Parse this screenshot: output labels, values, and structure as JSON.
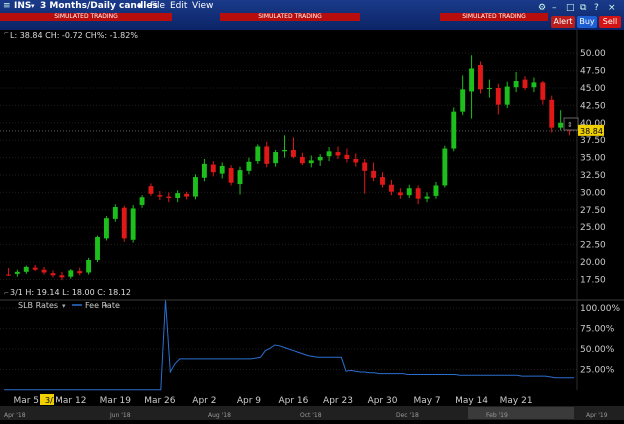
{
  "toolbar": {
    "ticker": "INS",
    "timeframe": "3 Months/Daily candles",
    "menu": [
      "File",
      "Edit",
      "View"
    ],
    "simulated": [
      "SIMULATED TRADING",
      "SIMULATED TRADING",
      "SIMULATED TRADING"
    ],
    "buttons": {
      "alert": "Alert",
      "buy": "Buy",
      "sell": "Sell"
    }
  },
  "colors": {
    "up": "#1cbf1c",
    "down": "#e01818",
    "accent": "#0c2466",
    "line": "#2a6fd0",
    "last_price_bg": "#f0d000"
  },
  "price_info": "L: 38.84 CH: -0.72 CH%: -1.82%",
  "ohlc_info": "3/1   H: 19.14  L: 18.00  C: 18.12",
  "last_price": "38.84",
  "lower_panel": {
    "title": "SLB Rates",
    "legend": "Fee Rate"
  },
  "x_axis": {
    "labels": [
      "3/1",
      "Mar 5",
      "Mar 12",
      "Mar 19",
      "Mar 26",
      "Apr 2",
      "Apr 9",
      "Apr 16",
      "Apr 23",
      "Apr 30",
      "May 7",
      "May 14",
      "May 21"
    ]
  },
  "scrollbar": {
    "labels": [
      "Apr '18",
      "Jun '18",
      "Aug '18",
      "Oct '18",
      "Dec '18",
      "Feb '19",
      "Apr '19"
    ]
  },
  "chart_data": [
    {
      "type": "candlestick",
      "y_ticks": [
        "17.50",
        "20.00",
        "22.50",
        "25.00",
        "27.50",
        "30.00",
        "32.50",
        "35.00",
        "37.50",
        "40.00",
        "42.50",
        "45.00",
        "47.50",
        "50.00"
      ],
      "ylim": [
        15.7,
        51.6
      ],
      "candles": [
        [
          18.2,
          19.14,
          18.0,
          18.12
        ],
        [
          18.3,
          18.9,
          17.9,
          18.6
        ],
        [
          18.6,
          19.5,
          18.3,
          19.3
        ],
        [
          19.2,
          19.6,
          18.7,
          18.9
        ],
        [
          18.9,
          19.3,
          18.2,
          18.5
        ],
        [
          18.4,
          18.8,
          17.8,
          18.1
        ],
        [
          18.1,
          18.6,
          17.4,
          17.8
        ],
        [
          17.9,
          19.0,
          17.6,
          18.8
        ],
        [
          18.7,
          19.2,
          18.1,
          18.4
        ],
        [
          18.5,
          20.6,
          18.2,
          20.3
        ],
        [
          20.3,
          23.8,
          20.0,
          23.6
        ],
        [
          23.4,
          26.6,
          23.1,
          26.3
        ],
        [
          26.2,
          28.3,
          25.8,
          27.9
        ],
        [
          27.8,
          28.1,
          22.9,
          23.4
        ],
        [
          23.2,
          28.2,
          22.8,
          27.7
        ],
        [
          28.2,
          29.6,
          27.8,
          29.3
        ],
        [
          30.9,
          31.3,
          29.5,
          29.8
        ],
        [
          29.6,
          30.2,
          28.9,
          29.4
        ],
        [
          29.4,
          30.0,
          28.6,
          29.2
        ],
        [
          29.2,
          30.3,
          28.6,
          29.9
        ],
        [
          29.8,
          30.1,
          29.0,
          29.4
        ],
        [
          29.4,
          32.6,
          29.0,
          32.2
        ],
        [
          32.1,
          34.8,
          31.6,
          34.1
        ],
        [
          34.0,
          34.5,
          32.3,
          32.9
        ],
        [
          32.7,
          34.3,
          32.0,
          33.8
        ],
        [
          33.5,
          33.9,
          31.0,
          31.4
        ],
        [
          31.2,
          33.7,
          29.7,
          33.2
        ],
        [
          33.1,
          35.0,
          32.6,
          34.4
        ],
        [
          34.5,
          36.9,
          34.1,
          36.6
        ],
        [
          36.6,
          37.3,
          33.6,
          34.1
        ],
        [
          34.2,
          36.1,
          33.7,
          35.8
        ],
        [
          35.9,
          38.2,
          35.0,
          36.1
        ],
        [
          36.1,
          37.9,
          34.9,
          35.1
        ],
        [
          35.1,
          35.7,
          33.9,
          34.2
        ],
        [
          34.2,
          35.3,
          33.6,
          34.6
        ],
        [
          34.6,
          35.5,
          33.8,
          35.1
        ],
        [
          35.2,
          36.5,
          34.5,
          35.9
        ],
        [
          35.8,
          36.6,
          34.8,
          35.3
        ],
        [
          35.4,
          36.3,
          34.3,
          34.8
        ],
        [
          34.8,
          35.6,
          33.7,
          34.3
        ],
        [
          34.3,
          34.8,
          29.8,
          33.1
        ],
        [
          33.1,
          34.3,
          31.6,
          32.1
        ],
        [
          32.2,
          32.9,
          30.7,
          31.1
        ],
        [
          31.1,
          31.8,
          29.6,
          30.1
        ],
        [
          30.0,
          30.6,
          29.1,
          29.6
        ],
        [
          29.6,
          31.1,
          29.2,
          30.6
        ],
        [
          30.6,
          31.0,
          28.3,
          29.1
        ],
        [
          29.1,
          30.0,
          28.6,
          29.4
        ],
        [
          29.5,
          31.5,
          29.1,
          31.0
        ],
        [
          31.0,
          36.7,
          30.7,
          36.3
        ],
        [
          36.3,
          42.2,
          35.9,
          41.6
        ],
        [
          41.6,
          46.8,
          41.1,
          44.8
        ],
        [
          44.5,
          49.7,
          40.6,
          47.8
        ],
        [
          48.3,
          48.8,
          44.2,
          44.8
        ],
        [
          44.9,
          46.2,
          43.6,
          45.0
        ],
        [
          45.0,
          45.6,
          41.2,
          42.6
        ],
        [
          42.6,
          45.9,
          42.1,
          45.2
        ],
        [
          45.1,
          47.3,
          44.4,
          46.0
        ],
        [
          46.2,
          46.7,
          44.7,
          45.0
        ],
        [
          45.1,
          46.5,
          44.4,
          45.8
        ],
        [
          45.8,
          46.0,
          42.6,
          43.3
        ],
        [
          43.3,
          43.9,
          38.6,
          39.3
        ],
        [
          39.3,
          41.8,
          38.9,
          40.0
        ],
        [
          40.0,
          40.3,
          38.2,
          38.84
        ]
      ]
    },
    {
      "type": "line",
      "name": "Fee Rate",
      "y_ticks": [
        "25.00%",
        "50.00%",
        "75.00%",
        "100.00%"
      ],
      "ylim": [
        0,
        110
      ],
      "values": [
        0.4,
        0.4,
        0.4,
        0.4,
        0.4,
        0.4,
        0.4,
        0.4,
        0.4,
        0.4,
        0.4,
        0.4,
        0.4,
        0.4,
        0.4,
        0.4,
        0.4,
        0.4,
        0.4,
        0.4,
        0.4,
        0.4,
        0.4,
        0.4,
        0.4,
        0.4,
        0.4,
        0.4,
        0.4,
        0.4,
        0.4,
        0.4,
        0.4,
        0.4,
        110,
        22,
        32,
        38,
        38,
        38,
        38,
        38,
        38,
        38,
        38,
        38,
        38,
        38,
        38,
        38,
        38,
        38,
        38,
        39,
        40,
        48,
        51,
        55,
        54,
        52,
        50,
        48,
        46,
        44,
        42,
        41,
        40,
        40,
        40,
        40,
        40,
        40,
        23,
        24,
        23,
        22,
        22,
        21,
        21,
        20,
        20,
        20,
        20,
        20,
        20,
        19,
        19,
        19,
        19,
        19,
        19,
        19,
        19,
        19,
        19,
        19,
        18,
        18,
        18,
        18,
        18,
        18,
        18,
        18,
        18,
        18,
        18,
        18,
        18,
        17,
        17,
        17,
        17,
        17,
        17,
        16,
        15,
        15,
        15,
        15,
        15
      ]
    }
  ]
}
